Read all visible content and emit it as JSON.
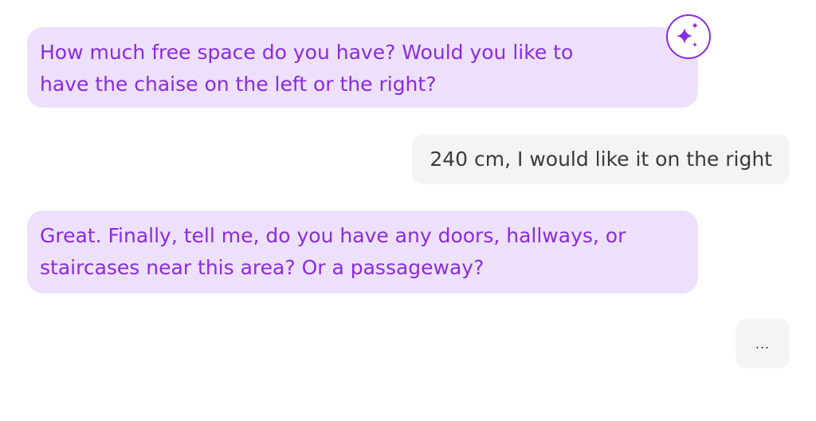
{
  "colors": {
    "assistant_bubble": "#ede0fb",
    "assistant_text": "#8a2be2",
    "user_bubble": "#f4f4f4",
    "user_text": "#3a3a3a",
    "icon_stroke": "#8a2be2"
  },
  "assistant_icon": "sparkles-icon",
  "messages": [
    {
      "role": "assistant",
      "lines": [
        "How much free space do you have? Would you like to",
        "have the chaise on the left or the right?"
      ]
    },
    {
      "role": "user",
      "text": "240 cm, I would like it on the right"
    },
    {
      "role": "assistant",
      "lines": [
        "Great. Finally, tell me, do you have any doors, hallways, or",
        "staircases near this area? Or a passageway?"
      ]
    }
  ],
  "typing_indicator": "..."
}
